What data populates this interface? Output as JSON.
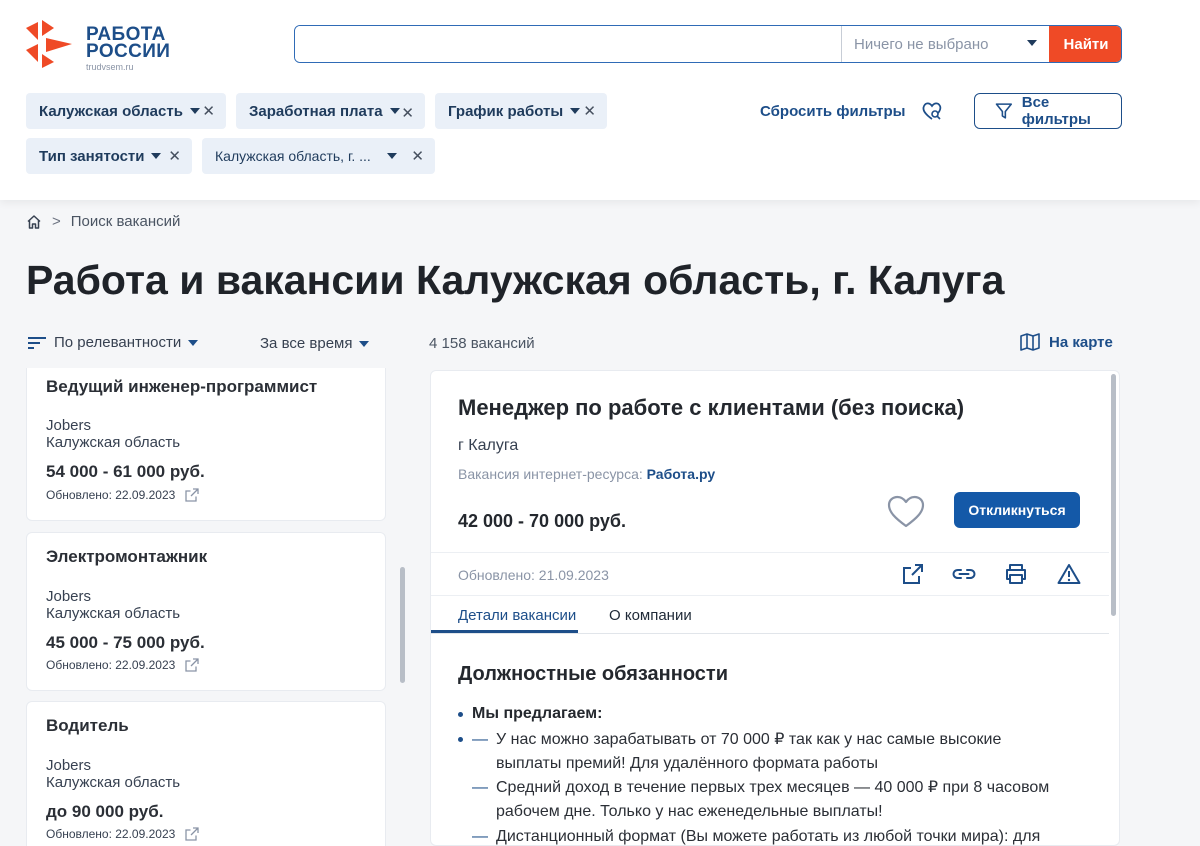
{
  "logo": {
    "line1": "РАБОТА",
    "line2": "РОССИИ",
    "sub": "trudvsem.ru"
  },
  "search": {
    "value": "",
    "placeholder": "",
    "region_select": "Ничего не выбрано",
    "button": "Найти"
  },
  "filters": {
    "chips": [
      {
        "label": "Калужская область"
      },
      {
        "label": "Заработная плата"
      },
      {
        "label": "График работы"
      },
      {
        "label": "Тип занятости"
      },
      {
        "label": "Калужская область, г. ..."
      }
    ],
    "reset": "Сбросить фильтры",
    "all": "Все фильтры"
  },
  "breadcrumb": {
    "current": "Поиск вакансий"
  },
  "page_title": "Работа и вакансии Калужская область, г. Калуга",
  "sorting": {
    "sort": "По релевантности",
    "period": "За все время",
    "count": "4 158 вакансий",
    "map": "На карте"
  },
  "list": [
    {
      "title": "Ведущий инженер-программист",
      "company": "Jobers",
      "region": "Калужская область",
      "salary": "54 000 - 61 000 руб.",
      "updated": "Обновлено: 22.09.2023"
    },
    {
      "title": "Электромонтажник",
      "company": "Jobers",
      "region": "Калужская область",
      "salary": "45 000 - 75 000 руб.",
      "updated": "Обновлено: 22.09.2023"
    },
    {
      "title": "Водитель",
      "company": "Jobers",
      "region": "Калужская область",
      "salary": "до 90 000 руб.",
      "updated": "Обновлено: 22.09.2023"
    }
  ],
  "detail": {
    "title": "Менеджер по работе с клиентами (без поиска)",
    "city": "г Калуга",
    "source_label": "Вакансия интернет-ресурса:",
    "source_link": "Работа.ру",
    "salary": "42 000 - 70 000 руб.",
    "apply": "Откликнуться",
    "updated": "Обновлено: 21.09.2023",
    "tabs": [
      "Детали вакансии",
      "О компании"
    ],
    "section": "Должностные обязанности",
    "offer": "Мы предлагаем:",
    "items": [
      {
        "line1": "У нас можно зарабатывать от 70 000 ₽ так как у нас самые высокие",
        "line2": "выплаты премий! Для удалённого формата работы"
      },
      {
        "line1": "Средний доход в течение первых трех месяцев — 40 000 ₽ при 8 часовом",
        "line2": "рабочем дне. Только у нас еженедельные выплаты!"
      },
      {
        "line1": "Дистанционный формат (Вы можете работать из любой точки мира): для",
        "line2": ""
      }
    ]
  },
  "colors": {
    "brand_blue": "#1d4e89",
    "accent_orange": "#ef4a26",
    "apply_blue": "#1459a8",
    "logo_red": "#ef4a26"
  }
}
